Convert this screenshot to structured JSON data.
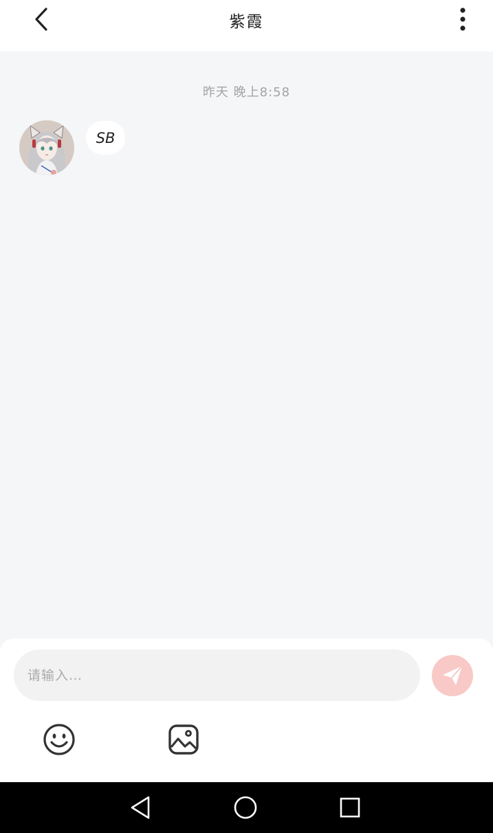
{
  "header": {
    "title": "紫霞",
    "back_icon": "chevron-left-icon",
    "more_icon": "more-vertical-icon"
  },
  "chat": {
    "timestamp": "昨天 晚上8:58",
    "messages": [
      {
        "sender": "紫霞",
        "side": "left",
        "avatar_icon": "anime-girl-avatar",
        "text": "SB"
      }
    ]
  },
  "composer": {
    "placeholder": "请输入…",
    "value": "",
    "send_icon": "paper-plane-icon",
    "emoji_icon": "smiley-face-icon",
    "image_icon": "image-icon"
  },
  "system_nav": {
    "back_icon": "triangle-back-icon",
    "home_icon": "circle-home-icon",
    "recent_icon": "square-recent-icon"
  },
  "colors": {
    "background": "#f5f6f8",
    "panel": "#ffffff",
    "input_bg": "#f2f2f2",
    "send_accent": "#f8c9c6",
    "nav_bar": "#000000"
  }
}
